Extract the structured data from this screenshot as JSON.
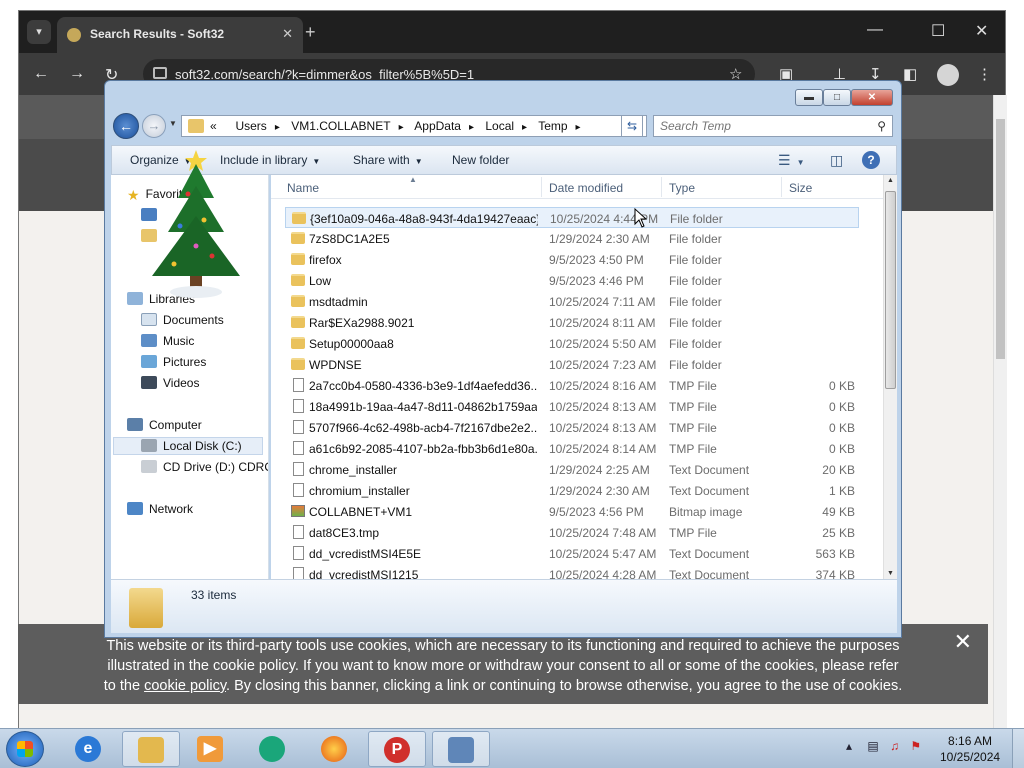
{
  "browser": {
    "tab_title": "Search Results - Soft32",
    "url": "soft32.com/search/?k=dimmer&os_filter%5B%5D=1"
  },
  "cookie_banner": {
    "line1": "This website or its third-party tools use cookies, which are necessary to its functioning and required to achieve the purposes",
    "line2": "illustrated in the cookie policy. If you want to know more or withdraw your consent to all or some of the cookies, please refer",
    "line3_before": "to the ",
    "line3_link": "cookie policy",
    "line3_after": ". By closing this banner, clicking a link or continuing to browse otherwise, you agree to the use of cookies."
  },
  "explorer": {
    "breadcrumbs": [
      "«",
      "Users",
      "VM1.COLLABNET",
      "AppData",
      "Local",
      "Temp"
    ],
    "search_placeholder": "Search Temp",
    "toolbar": {
      "organize": "Organize",
      "include": "Include in library",
      "share": "Share with",
      "new_folder": "New folder"
    },
    "nav": {
      "favorites": "Favorites",
      "libraries": "Libraries",
      "documents": "Documents",
      "music": "Music",
      "pictures": "Pictures",
      "videos": "Videos",
      "computer": "Computer",
      "local_disk": "Local Disk (C:)",
      "cd_drive": "CD Drive (D:) CDROM",
      "network": "Network"
    },
    "columns": {
      "name": "Name",
      "date": "Date modified",
      "type": "Type",
      "size": "Size"
    },
    "files": [
      {
        "name": "{3ef10a09-046a-48a8-943f-4da19427eaac}",
        "date": "10/25/2024 4:44 PM",
        "type": "File folder",
        "size": "",
        "kind": "folder"
      },
      {
        "name": "7zS8DC1A2E5",
        "date": "1/29/2024 2:30 AM",
        "type": "File folder",
        "size": "",
        "kind": "folder"
      },
      {
        "name": "firefox",
        "date": "9/5/2023 4:50 PM",
        "type": "File folder",
        "size": "",
        "kind": "folder"
      },
      {
        "name": "Low",
        "date": "9/5/2023 4:46 PM",
        "type": "File folder",
        "size": "",
        "kind": "folder"
      },
      {
        "name": "msdtadmin",
        "date": "10/25/2024 7:11 AM",
        "type": "File folder",
        "size": "",
        "kind": "folder"
      },
      {
        "name": "Rar$EXa2988.9021",
        "date": "10/25/2024 8:11 AM",
        "type": "File folder",
        "size": "",
        "kind": "folder"
      },
      {
        "name": "Setup00000aa8",
        "date": "10/25/2024 5:50 AM",
        "type": "File folder",
        "size": "",
        "kind": "folder"
      },
      {
        "name": "WPDNSE",
        "date": "10/25/2024 7:23 AM",
        "type": "File folder",
        "size": "",
        "kind": "folder"
      },
      {
        "name": "2a7cc0b4-0580-4336-b3e9-1df4aefedd36....",
        "date": "10/25/2024 8:16 AM",
        "type": "TMP File",
        "size": "0 KB",
        "kind": "file"
      },
      {
        "name": "18a4991b-19aa-4a47-8d11-04862b1759aa...",
        "date": "10/25/2024 8:13 AM",
        "type": "TMP File",
        "size": "0 KB",
        "kind": "file"
      },
      {
        "name": "5707f966-4c62-498b-acb4-7f2167dbe2e2....",
        "date": "10/25/2024 8:13 AM",
        "type": "TMP File",
        "size": "0 KB",
        "kind": "file"
      },
      {
        "name": "a61c6b92-2085-4107-bb2a-fbb3b6d1e80a...",
        "date": "10/25/2024 8:14 AM",
        "type": "TMP File",
        "size": "0 KB",
        "kind": "file"
      },
      {
        "name": "chrome_installer",
        "date": "1/29/2024 2:25 AM",
        "type": "Text Document",
        "size": "20 KB",
        "kind": "file"
      },
      {
        "name": "chromium_installer",
        "date": "1/29/2024 2:30 AM",
        "type": "Text Document",
        "size": "1 KB",
        "kind": "file"
      },
      {
        "name": "COLLABNET+VM1",
        "date": "9/5/2023 4:56 PM",
        "type": "Bitmap image",
        "size": "49 KB",
        "kind": "bmp"
      },
      {
        "name": "dat8CE3.tmp",
        "date": "10/25/2024 7:48 AM",
        "type": "TMP File",
        "size": "25 KB",
        "kind": "file"
      },
      {
        "name": "dd_vcredistMSI4E5E",
        "date": "10/25/2024 5:47 AM",
        "type": "Text Document",
        "size": "563 KB",
        "kind": "file"
      },
      {
        "name": "dd_vcredistMSI1215",
        "date": "10/25/2024 4:28 AM",
        "type": "Text Document",
        "size": "374 KB",
        "kind": "file"
      }
    ],
    "item_count": "33 items"
  },
  "taskbar": {
    "time": "8:16 AM",
    "date": "10/25/2024"
  }
}
